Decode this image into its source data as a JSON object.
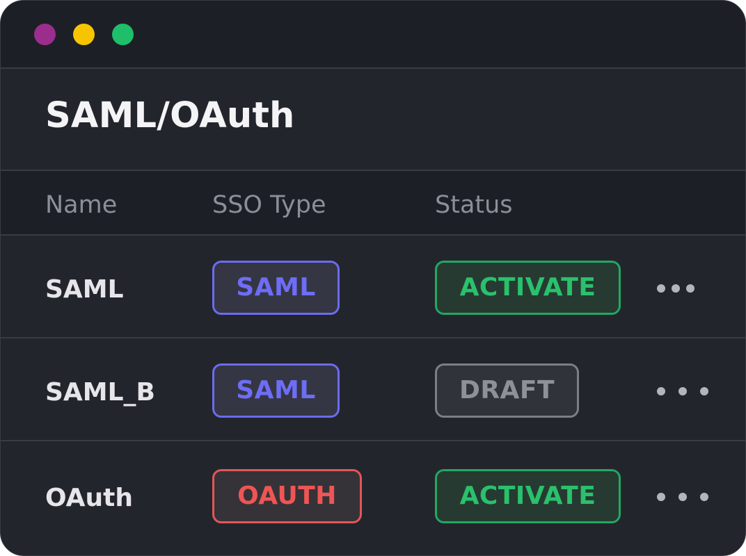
{
  "window": {
    "controls": [
      {
        "name": "close",
        "color": "#9b2d8d"
      },
      {
        "name": "minimize",
        "color": "#f7c400"
      },
      {
        "name": "maximize",
        "color": "#1fbe6a"
      }
    ]
  },
  "page": {
    "title": "SAML/OAuth"
  },
  "table": {
    "columns": [
      "Name",
      "SSO Type",
      "Status"
    ],
    "rows": [
      {
        "name": "SAML",
        "sso_type": "SAML",
        "status": "ACTIVATE",
        "actions_icon": "more-horizontal-icon"
      },
      {
        "name": "SAML_B",
        "sso_type": "SAML",
        "status": "DRAFT",
        "actions_icon": "more-horizontal-icon"
      },
      {
        "name": "OAuth",
        "sso_type": "OAUTH",
        "status": "ACTIVATE",
        "actions_icon": "more-horizontal-icon"
      }
    ]
  },
  "colors": {
    "background": "#23252d",
    "saml": "#6b6cf0",
    "oauth": "#e15759",
    "activate": "#22a860",
    "draft": "#7d7f87"
  }
}
